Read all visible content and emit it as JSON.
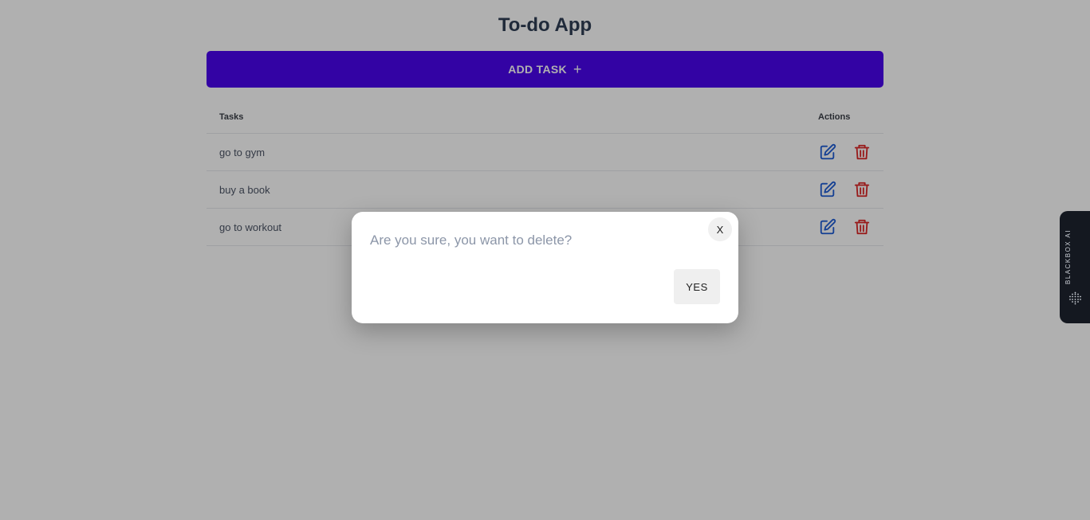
{
  "app": {
    "title": "To-do App",
    "add_button_label": "ADD TASK",
    "add_button_icon": "+",
    "accent_color": "#4a05ee"
  },
  "table": {
    "headers": {
      "tasks": "Tasks",
      "actions": "Actions"
    },
    "rows": [
      {
        "task": "go to gym"
      },
      {
        "task": "buy a book"
      },
      {
        "task": "go to workout"
      }
    ],
    "edit_icon": "edit-icon",
    "delete_icon": "trash-icon",
    "edit_color": "#1f5dd6",
    "delete_color": "#dc2626"
  },
  "modal": {
    "message": "Are you sure, you want to delete?",
    "close_label": "X",
    "confirm_label": "YES"
  },
  "side_tab": {
    "label": "BLACKBOX AI"
  }
}
